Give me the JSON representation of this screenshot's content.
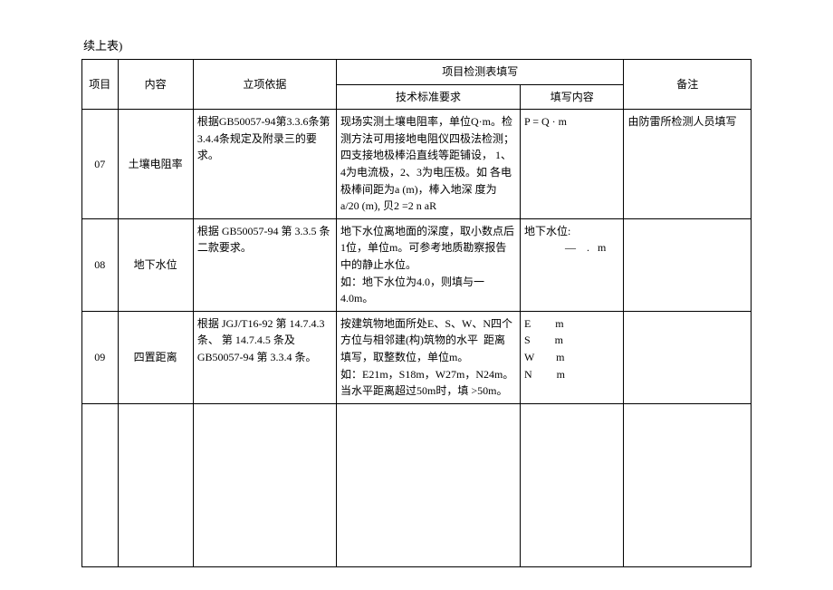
{
  "caption": "续上表)",
  "headers": {
    "project": "项目",
    "content": "内容",
    "basis": "立项依据",
    "measurement_group": "项目检测表填写",
    "tech_standard": "技术标准要求",
    "fill_content": "填写内容",
    "remark": "备注"
  },
  "rows": [
    {
      "project": "07",
      "content": "土壤电阻率",
      "basis": "根据GB50057-94第3.3.6条第 3.4.4条规定及附录三的要求。",
      "tech": "现场实测土壤电阻率，单位Q·m。检测方法可用接地电阻仪四极法检测；四支接地极棒沿直线等距铺设，  1、4为电流极，2、3为电压极。如  各电极棒间距为a (m)，棒入地深  度为 a/20 (m), 贝2 =2 n  aR",
      "fill": "P =          Q · m",
      "remark": "由防雷所检测人员填写"
    },
    {
      "project": "08",
      "content": "地下水位",
      "basis": "根据  GB50057-94 第  3.3.5 条二款要求。",
      "tech": "地下水位离地面的深度，取小数点后1位，单位m。可参考地质勘察报告中的静止水位。\n如：地下水位为4.0，则填与一4.0m。",
      "fill": "地下水位:\n               —    .   m",
      "remark": ""
    },
    {
      "project": "09",
      "content": "四置距离",
      "basis": "根据  JGJ/T16-92 第  14.7.4.3条、  第  14.7.4.5 条及  GB50057-94 第  3.3.4 条。",
      "tech": "按建筑物地面所处E、S、W、N四个方位与相邻建(构)筑物的水平  距离填写，取整数位，单位m。\n如：E21m，S18m，W27m，N24m。当水平距离超过50m时，填 >50m。",
      "fill": "E         m\nS         m\nW        m\nN         m",
      "remark": ""
    }
  ]
}
